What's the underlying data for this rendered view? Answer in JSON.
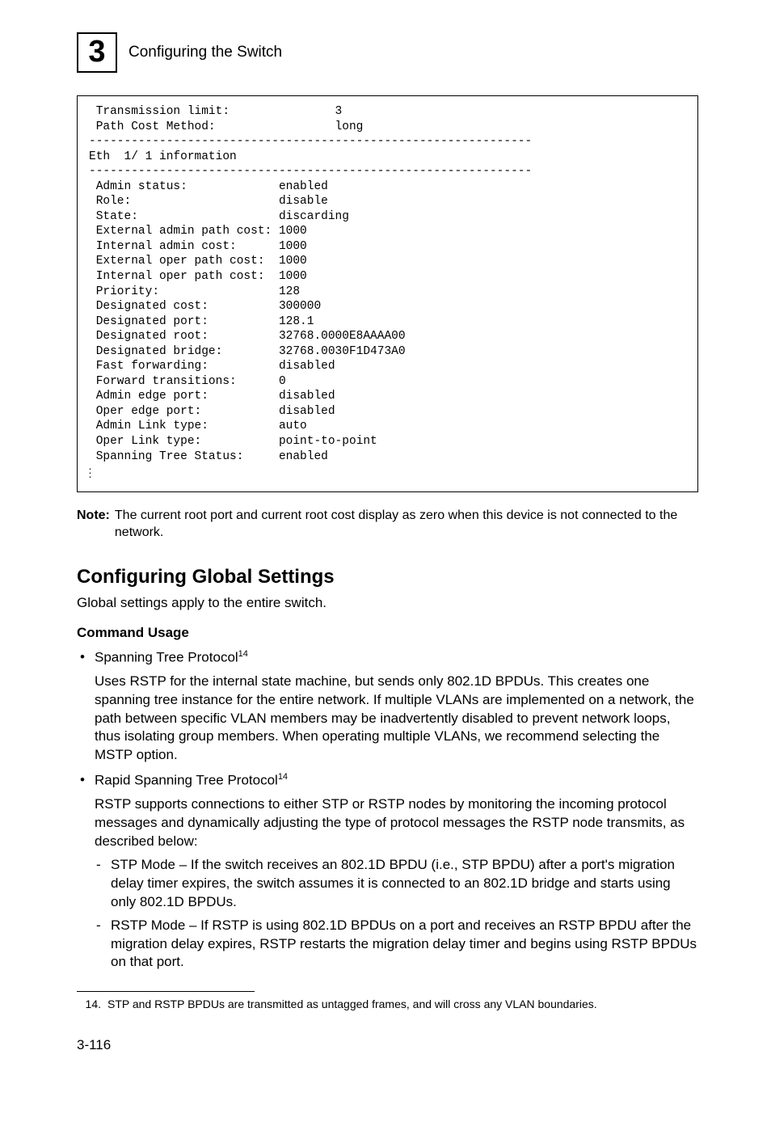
{
  "header": {
    "chapter_number": "3",
    "title": "Configuring the Switch"
  },
  "code": {
    "l1": " Transmission limit:               3",
    "l2": " Path Cost Method:                 long",
    "l3": "---------------------------------------------------------------",
    "l4": "Eth  1/ 1 information",
    "l5": "---------------------------------------------------------------",
    "l6": " Admin status:             enabled",
    "l7": " Role:                     disable",
    "l8": " State:                    discarding",
    "l9": " External admin path cost: 1000",
    "l10": " Internal admin cost:      1000",
    "l11": " External oper path cost:  1000",
    "l12": " Internal oper path cost:  1000",
    "l13": " Priority:                 128",
    "l14": " Designated cost:          300000",
    "l15": " Designated port:          128.1",
    "l16": " Designated root:          32768.0000E8AAAA00",
    "l17": " Designated bridge:        32768.0030F1D473A0",
    "l18": " Fast forwarding:          disabled",
    "l19": " Forward transitions:      0",
    "l20": " Admin edge port:          disabled",
    "l21": " Oper edge port:           disabled",
    "l22": " Admin Link type:          auto",
    "l23": " Oper Link type:           point-to-point",
    "l24": " Spanning Tree Status:     enabled",
    "l25": "..."
  },
  "note": {
    "label": "Note:",
    "text": "The current root port and current root cost display as zero when this device is not connected to the network."
  },
  "section": {
    "heading": "Configuring Global Settings",
    "intro": "Global settings apply to the entire switch.",
    "cmd_usage_heading": "Command Usage",
    "bullets": [
      {
        "title": "Spanning Tree Protocol",
        "sup": "14",
        "body": "Uses RSTP for the internal state machine, but sends only 802.1D BPDUs. This creates one spanning tree instance for the entire network. If multiple VLANs are implemented on a network, the path between specific VLAN members may be inadvertently disabled to prevent network loops, thus isolating group members. When operating multiple VLANs, we recommend selecting the MSTP option."
      },
      {
        "title": "Rapid Spanning Tree Protocol",
        "sup": "14",
        "body": "RSTP supports connections to either STP or RSTP nodes by monitoring the incoming protocol messages and dynamically adjusting the type of protocol messages the RSTP node transmits, as described below:",
        "sub": [
          "STP Mode – If the switch receives an 802.1D BPDU (i.e., STP BPDU) after a port's migration delay timer expires, the switch assumes it is connected to an 802.1D bridge and starts using only 802.1D BPDUs.",
          "RSTP Mode – If RSTP is using 802.1D BPDUs on a port and receives an RSTP BPDU after the migration delay expires, RSTP restarts the migration delay timer and begins using RSTP BPDUs on that port."
        ]
      }
    ]
  },
  "footnote": {
    "num": "14.",
    "text": "STP and RSTP BPDUs are transmitted as untagged frames, and will cross any VLAN boundaries."
  },
  "page_number": "3-116"
}
